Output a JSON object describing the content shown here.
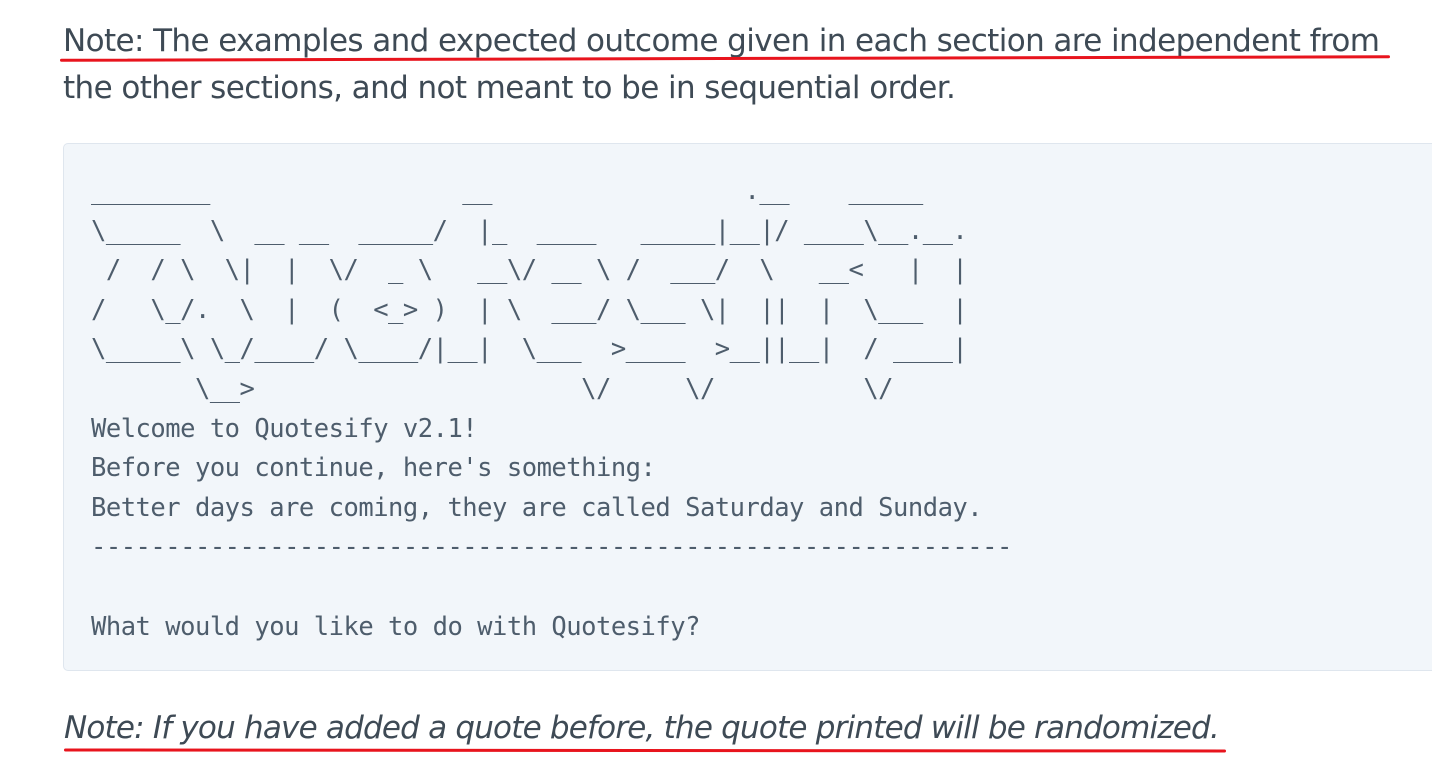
{
  "note_top": "Note: The examples and expected outcome given in each section are independent from the other sections, and not meant to be in sequential order.",
  "code_block": {
    "lines": [
      "________                 __                 .__    _____",
      "\\_____  \\  __ __  _____/  |_  ____   _____|__|/ ____\\__.__.",
      " /  / \\  \\|  |  \\/  _ \\   __\\/ __ \\ /  ___/  \\   __<   |  |",
      "/   \\_/.  \\  |  (  <_> )  | \\  ___/ \\___ \\|  ||  |  \\___  |",
      "\\_____\\ \\_/____/ \\____/|__|  \\___  >____  >__||__|  / ____|",
      "       \\__>                      \\/     \\/          \\/",
      "Welcome to Quotesify v2.1!",
      "Before you continue, here's something:",
      "Better days are coming, they are called Saturday and Sunday.",
      "--------------------------------------------------------------",
      "",
      "What would you like to do with Quotesify?"
    ]
  },
  "note_bottom": "Note: If you have added a quote before, the quote printed will be randomized."
}
